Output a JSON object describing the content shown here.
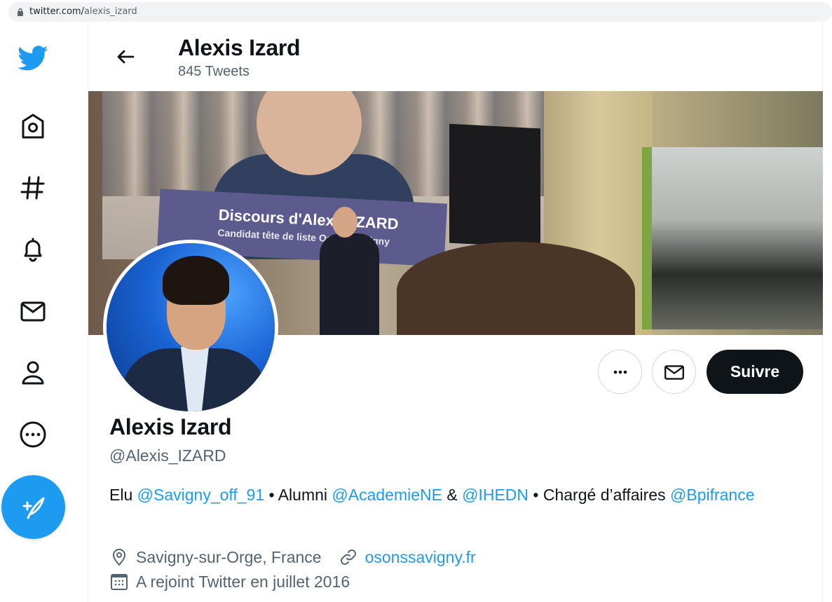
{
  "browser": {
    "url_host": "twitter.com/",
    "url_path": "alexis_izard"
  },
  "header": {
    "name": "Alexis Izard",
    "tweet_count": "845 Tweets"
  },
  "banner": {
    "screen_title": "Discours d'Alexis IZARD",
    "screen_subtitle": "Candidat tête de liste Osons Savigny"
  },
  "actions": {
    "follow_label": "Suivre"
  },
  "profile": {
    "display_name": "Alexis Izard",
    "handle": "@Alexis_IZARD",
    "bio": {
      "t1": "Elu ",
      "m1": "@Savigny_off_91",
      "t2": " • Alumni ",
      "m2": "@AcademieNE",
      "t3": " & ",
      "m3": "@IHEDN",
      "t4": " • Chargé d’affaires ",
      "m4": "@Bpifrance"
    },
    "location": "Savigny-sur-Orge, France",
    "website": "osonssavigny.fr",
    "joined": "A rejoint Twitter en juillet 2016"
  },
  "colors": {
    "accent": "#1d9bf0",
    "text": "#0f1419",
    "secondary": "#536471"
  },
  "icons": [
    "twitter-logo-icon",
    "home-icon",
    "hashtag-icon",
    "bell-icon",
    "mail-icon",
    "profile-icon",
    "more-icon",
    "compose-icon",
    "back-arrow-icon",
    "location-icon",
    "link-icon",
    "calendar-icon"
  ]
}
